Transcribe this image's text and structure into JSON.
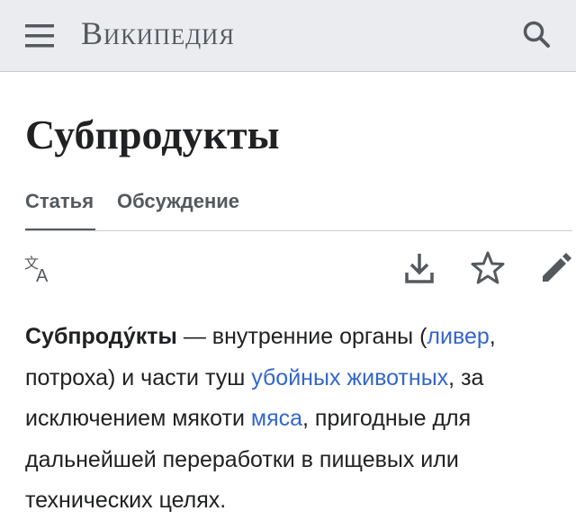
{
  "header": {
    "wordmark": "Википедия",
    "menu_icon": "hamburger-menu-icon",
    "search_icon": "search-icon"
  },
  "page": {
    "title": "Субпродукты"
  },
  "tabs": [
    {
      "label": "Статья",
      "active": true
    },
    {
      "label": "Обсуждение",
      "active": false
    }
  ],
  "actions": {
    "language_icon": "language-icon",
    "download_icon": "download-icon",
    "watch_icon": "star-icon",
    "edit_icon": "pencil-icon"
  },
  "content": {
    "lead_term": "Субпроду́кты",
    "t1": " — внутренние органы (",
    "link_liver": "ливер",
    "t2": ", потроха) и части туш ",
    "link_animals": "убойных животных",
    "t3": ", за исключением мякоти ",
    "link_meat": "мяса",
    "t4": ", пригодные для дальнейшей переработки в пищевых или технических целях."
  },
  "colors": {
    "header_bg": "#eaecf0",
    "text": "#202122",
    "link": "#3366cc",
    "icon": "#54595d"
  }
}
